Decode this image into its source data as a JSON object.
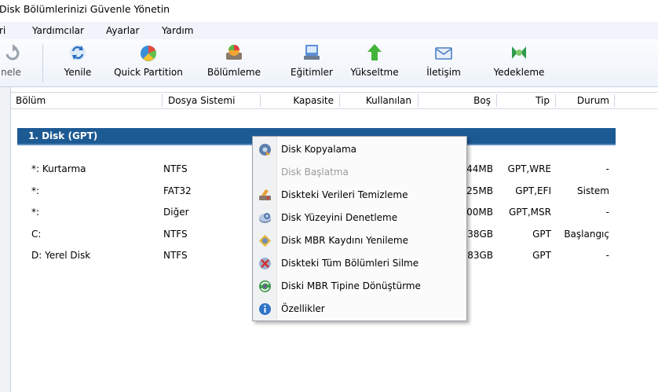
{
  "window": {
    "title": "Disk Bölümlerinizi Güvenle Yönetin"
  },
  "menubar": {
    "items": [
      "ri",
      "Yardımcılar",
      "Ayarlar",
      "Yardım"
    ]
  },
  "toolbar": {
    "undo_label": "nele",
    "buttons": [
      "Yenile",
      "Quick Partition",
      "Bölümleme",
      "Eğitimler",
      "Yükseltme",
      "İletişim",
      "Yedekleme"
    ]
  },
  "columns": [
    "Bölüm",
    "Dosya Sistemi",
    "Kapasite",
    "Kullanılan",
    "Boş",
    "Tip",
    "Durum"
  ],
  "disk": {
    "header": "1. Disk (GPT)",
    "rows": [
      {
        "name": "*: Kurtarma",
        "fs": "NTFS",
        "free": "44MB",
        "type": "GPT,WRE",
        "status": "-"
      },
      {
        "name": "*:",
        "fs": "FAT32",
        "free": "25MB",
        "type": "GPT,EFI",
        "status": "Sistem"
      },
      {
        "name": "*:",
        "fs": "Diğer",
        "free": "00MB",
        "type": "GPT,MSR",
        "status": "-"
      },
      {
        "name": "C:",
        "fs": "NTFS",
        "free": "38GB",
        "type": "GPT",
        "status": "Başlangıç"
      },
      {
        "name": "D: Yerel Disk",
        "fs": "NTFS",
        "free": "83GB",
        "type": "GPT",
        "status": "-"
      }
    ]
  },
  "context_menu": {
    "items": [
      {
        "label": "Disk Kopyalama",
        "icon": "disk-copy-icon",
        "enabled": true
      },
      {
        "label": "Disk Başlatma",
        "icon": "",
        "enabled": false
      },
      {
        "label": "Diskteki Verileri Temizleme",
        "icon": "wipe-data-icon",
        "enabled": true
      },
      {
        "label": "Disk Yüzeyini Denetleme",
        "icon": "surface-test-icon",
        "enabled": true
      },
      {
        "label": "Disk MBR Kaydını Yenileme",
        "icon": "rebuild-mbr-icon",
        "enabled": true
      },
      {
        "label": "Diskteki Tüm Bölümleri Silme",
        "icon": "delete-partitions-icon",
        "enabled": true
      },
      {
        "label": "Diski MBR Tipine Dönüştürme",
        "icon": "convert-mbr-icon",
        "enabled": true
      },
      {
        "label": "Özellikler",
        "icon": "info-icon",
        "enabled": true
      }
    ]
  },
  "colors": {
    "disk_header_bg": "#1c5a94",
    "toolbar_bg": "#eef3fa"
  }
}
